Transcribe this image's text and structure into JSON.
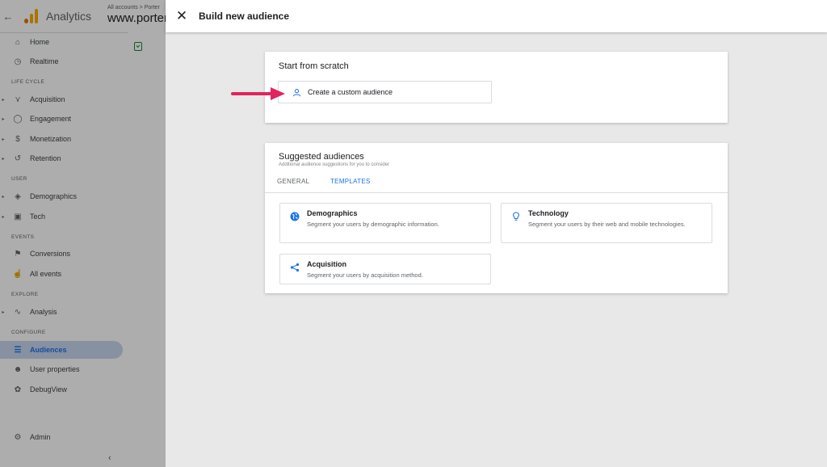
{
  "app": {
    "name": "Analytics",
    "breadcrumb": "All accounts > Porter",
    "property": "www.porter"
  },
  "sidebar": {
    "items": [
      {
        "label": "Home",
        "icon": "home-icon"
      },
      {
        "label": "Realtime",
        "icon": "clock-icon"
      },
      {
        "label": "Acquisition",
        "icon": "acquisition-icon"
      },
      {
        "label": "Engagement",
        "icon": "tag-icon"
      },
      {
        "label": "Monetization",
        "icon": "dollar-icon"
      },
      {
        "label": "Retention",
        "icon": "retention-icon"
      },
      {
        "label": "Demographics",
        "icon": "globe-icon"
      },
      {
        "label": "Tech",
        "icon": "devices-icon"
      },
      {
        "label": "Conversions",
        "icon": "flag-icon"
      },
      {
        "label": "All events",
        "icon": "touch-icon"
      },
      {
        "label": "Analysis",
        "icon": "analysis-icon"
      },
      {
        "label": "Audiences",
        "icon": "audiences-icon"
      },
      {
        "label": "User properties",
        "icon": "user-icon"
      },
      {
        "label": "DebugView",
        "icon": "debug-icon"
      },
      {
        "label": "Admin",
        "icon": "gear-icon"
      }
    ],
    "sections": [
      "LIFE CYCLE",
      "USER",
      "EVENTS",
      "EXPLORE",
      "CONFIGURE"
    ],
    "collapse_glyph": "‹"
  },
  "panel": {
    "title": "Build new audience",
    "scratch": {
      "title": "Start from scratch",
      "button_label": "Create a custom audience"
    },
    "suggested": {
      "title": "Suggested audiences",
      "subtitle": "Additional audience suggestions for you to consider",
      "tabs": [
        "GENERAL",
        "TEMPLATES"
      ],
      "active_tab": "TEMPLATES",
      "tiles": [
        {
          "title": "Demographics",
          "description": "Segment your users by demographic information.",
          "icon": "globe-icon"
        },
        {
          "title": "Technology",
          "description": "Segment your users by their web and mobile technologies.",
          "icon": "lightbulb-icon"
        },
        {
          "title": "Acquisition",
          "description": "Segment your users by acquisition method.",
          "icon": "share-icon"
        }
      ]
    }
  },
  "colors": {
    "accent": "#1a73e8",
    "arrow": "#e0245e",
    "logo": "#f9ab00"
  }
}
